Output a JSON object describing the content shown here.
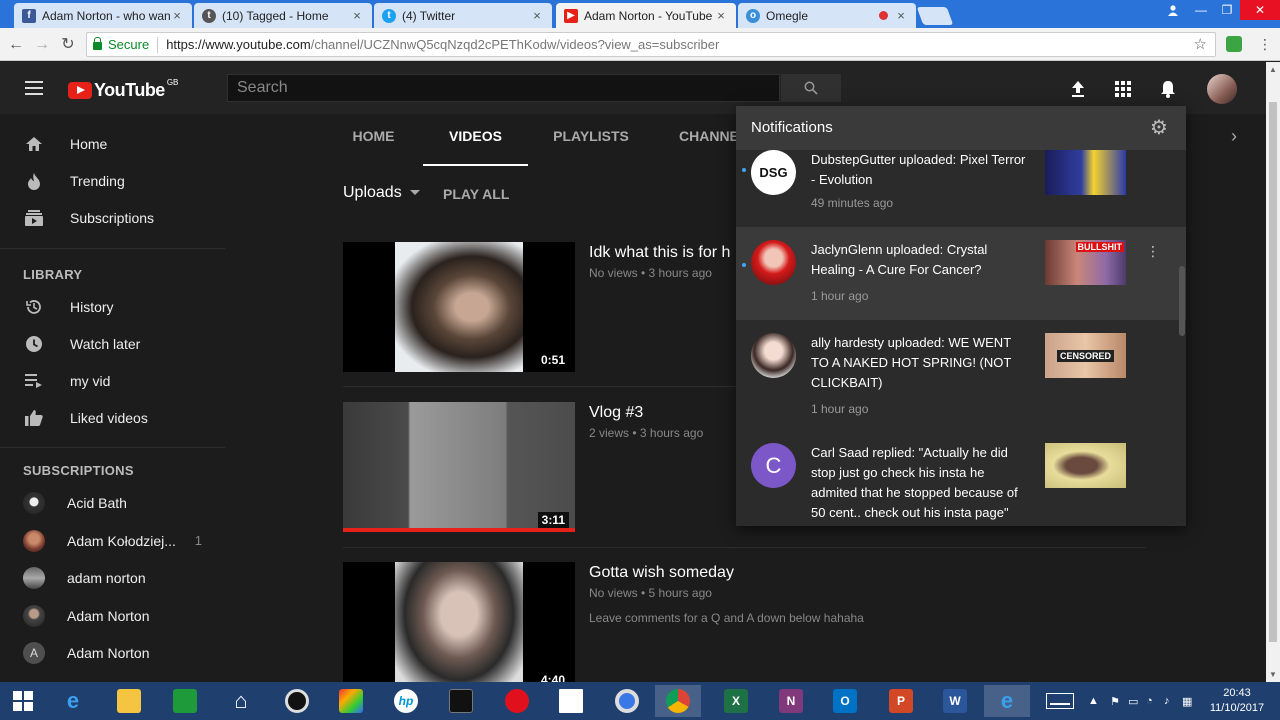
{
  "browser": {
    "tabs": [
      {
        "label": "Adam Norton - who wan",
        "icon": "facebook-icon",
        "color": "#3b5998"
      },
      {
        "label": "(10) Tagged - Home",
        "icon": "tagged-icon",
        "color": "#555555"
      },
      {
        "label": "(4) Twitter",
        "icon": "twitter-icon",
        "color": "#1da1f2"
      },
      {
        "label": "Adam Norton - YouTube",
        "icon": "youtube-icon",
        "color": "#e62117"
      },
      {
        "label": "Omegle",
        "icon": "omegle-icon",
        "color": "#3a8fd8"
      }
    ],
    "secure_label": "Secure",
    "url_host": "https://www.youtube.com",
    "url_path": "/channel/UCZNnwQ5cqNzqd2cPEThKodw/videos?view_as=subscriber"
  },
  "youtube": {
    "logo_text": "YouTube",
    "region": "GB",
    "search_placeholder": "Search",
    "sidebar": {
      "main": [
        {
          "label": "Home",
          "icon": "home-icon"
        },
        {
          "label": "Trending",
          "icon": "trending-icon"
        },
        {
          "label": "Subscriptions",
          "icon": "subscriptions-icon"
        }
      ],
      "library_heading": "LIBRARY",
      "library": [
        {
          "label": "History",
          "icon": "history-icon"
        },
        {
          "label": "Watch later",
          "icon": "watch-later-icon"
        },
        {
          "label": "my vid",
          "icon": "playlist-icon"
        },
        {
          "label": "Liked videos",
          "icon": "thumbs-up-icon"
        }
      ],
      "subscriptions_heading": "SUBSCRIPTIONS",
      "subscriptions": [
        {
          "label": "Acid Bath",
          "count": ""
        },
        {
          "label": "Adam Kołodziej...",
          "count": "1"
        },
        {
          "label": "adam norton",
          "count": ""
        },
        {
          "label": "Adam Norton",
          "count": ""
        },
        {
          "label": "Adam Norton",
          "count": "",
          "initial": "A"
        }
      ]
    },
    "channel_tabs": [
      "HOME",
      "VIDEOS",
      "PLAYLISTS",
      "CHANNE"
    ],
    "uploads_label": "Uploads",
    "play_all_label": "PLAY ALL",
    "videos": [
      {
        "title": "Idk what this is for h",
        "meta": "No views • 3 hours ago",
        "duration": "0:51",
        "description": ""
      },
      {
        "title": "Vlog #3",
        "meta": "2 views • 3 hours ago",
        "duration": "3:11",
        "description": "",
        "watched": 1.0
      },
      {
        "title": "Gotta wish someday",
        "meta": "No views • 5 hours ago",
        "duration": "4:40",
        "description": "Leave comments for a Q and A down below hahaha"
      }
    ],
    "notifications": {
      "heading": "Notifications",
      "items": [
        {
          "text": "DubstepGutter uploaded: Pixel Terror - Evolution",
          "time": "49 minutes ago",
          "avatar_text": "DSG"
        },
        {
          "text": "JaclynGlenn uploaded: Crystal Healing - A Cure For Cancer?",
          "time": "1 hour ago",
          "thumb_text": "BULLSHIT"
        },
        {
          "text": "ally hardesty uploaded: WE WENT TO A NAKED HOT SPRING! (NOT CLICKBAIT)",
          "time": "1 hour ago",
          "thumb_text": "CENSORED"
        },
        {
          "text": "Carl Saad replied: \"Actually he did stop just go check his insta he admited that he stopped because of 50 cent.. check out his insta page\"",
          "time": "",
          "avatar_text": "C"
        }
      ]
    }
  },
  "taskbar": {
    "time": "20:43",
    "date": "11/10/2017"
  }
}
